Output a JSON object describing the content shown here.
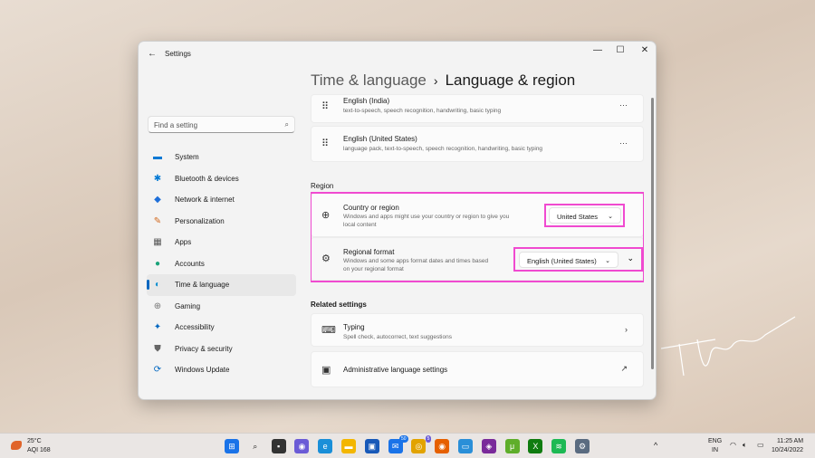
{
  "window": {
    "title": "Settings",
    "minimize": "—",
    "maximize": "☐",
    "close": "✕"
  },
  "header": {
    "parent": "Time & language",
    "separator": "›",
    "current": "Language & region"
  },
  "search": {
    "placeholder": "Find a setting"
  },
  "sidebar": {
    "items": [
      {
        "label": "System",
        "icon": "monitor-icon",
        "glyph": "▬",
        "color": "#0078d4"
      },
      {
        "label": "Bluetooth & devices",
        "icon": "bluetooth-icon",
        "glyph": "✱",
        "color": "#0078d4"
      },
      {
        "label": "Network & internet",
        "icon": "wifi-icon",
        "glyph": "◆",
        "color": "#1e6fd9"
      },
      {
        "label": "Personalization",
        "icon": "brush-icon",
        "glyph": "✎",
        "color": "#d2691e"
      },
      {
        "label": "Apps",
        "icon": "apps-icon",
        "glyph": "▦",
        "color": "#555"
      },
      {
        "label": "Accounts",
        "icon": "person-icon",
        "glyph": "●",
        "color": "#1aa37a"
      },
      {
        "label": "Time & language",
        "icon": "globe-clock-icon",
        "glyph": "◐",
        "color": "#0a8fd0"
      },
      {
        "label": "Gaming",
        "icon": "gamepad-icon",
        "glyph": "⊕",
        "color": "#777"
      },
      {
        "label": "Accessibility",
        "icon": "accessibility-icon",
        "glyph": "✦",
        "color": "#0067c0"
      },
      {
        "label": "Privacy & security",
        "icon": "shield-icon",
        "glyph": "⛊",
        "color": "#666"
      },
      {
        "label": "Windows Update",
        "icon": "update-icon",
        "glyph": "⟳",
        "color": "#0067c0"
      }
    ],
    "selected": 6
  },
  "languages": [
    {
      "name": "English (India)",
      "features": "text-to-speech, speech recognition, handwriting, basic typing"
    },
    {
      "name": "English (United States)",
      "features": "language pack, text-to-speech, speech recognition, handwriting, basic typing"
    }
  ],
  "region": {
    "heading": "Region",
    "country": {
      "title": "Country or region",
      "desc1": "Windows and apps might use your country or region to give you",
      "desc2": "local content",
      "value": "United States"
    },
    "format": {
      "title": "Regional format",
      "desc1": "Windows and some apps format dates and times based",
      "desc2": "on your regional format",
      "value": "English (United States)"
    }
  },
  "related": {
    "heading": "Related settings",
    "typing": {
      "title": "Typing",
      "desc": "Spell check, autocorrect, text suggestions"
    },
    "admin": {
      "title": "Administrative language settings"
    }
  },
  "taskbar": {
    "weather_temp": "25°C",
    "weather_aqi": "AQI 168",
    "lang1": "ENG",
    "lang2": "IN",
    "time": "11:25 AM",
    "date": "10/24/2022",
    "mail_badge": "50",
    "chrome_badge": "5"
  }
}
